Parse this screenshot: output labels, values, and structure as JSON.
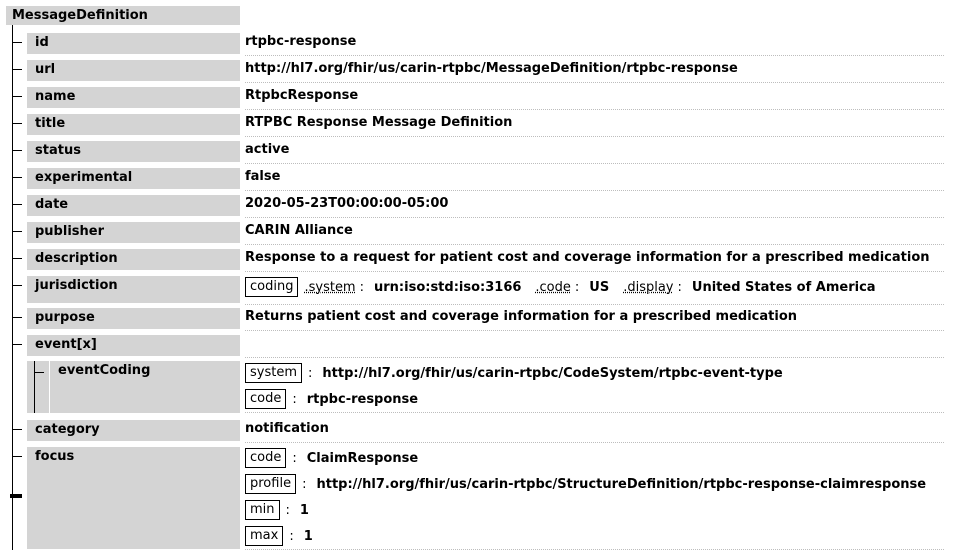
{
  "root_label": "MessageDefinition",
  "elements": {
    "id": {
      "label": "id",
      "value": "rtpbc-response"
    },
    "url": {
      "label": "url",
      "value": "http://hl7.org/fhir/us/carin-rtpbc/MessageDefinition/rtpbc-response"
    },
    "name": {
      "label": "name",
      "value": "RtpbcResponse"
    },
    "title": {
      "label": "title",
      "value": "RTPBC Response Message Definition"
    },
    "status": {
      "label": "status",
      "value": "active"
    },
    "experimental": {
      "label": "experimental",
      "value": "false"
    },
    "date": {
      "label": "date",
      "value": "2020-05-23T00:00:00-05:00"
    },
    "publisher": {
      "label": "publisher",
      "value": "CARIN Alliance"
    },
    "description": {
      "label": "description",
      "value": "Response to a request for patient cost and coverage information for a prescribed medication"
    },
    "jurisdiction": {
      "label": "jurisdiction",
      "coding_label": "coding",
      "system_label": ".system",
      "system_value": "urn:iso:std:iso:3166",
      "code_label": ".code",
      "code_value": "US",
      "display_label": ".display",
      "display_value": "United States of America"
    },
    "purpose": {
      "label": "purpose",
      "value": "Returns patient cost and coverage information for a prescribed medication"
    },
    "event": {
      "label": "event[x]",
      "eventCoding": {
        "label": "eventCoding",
        "system_label": "system",
        "system_value": "http://hl7.org/fhir/us/carin-rtpbc/CodeSystem/rtpbc-event-type",
        "code_label": "code",
        "code_value": "rtpbc-response"
      }
    },
    "category": {
      "label": "category",
      "value": "notification"
    },
    "focus": {
      "label": "focus",
      "code_label": "code",
      "code_value": "ClaimResponse",
      "profile_label": "profile",
      "profile_value": "http://hl7.org/fhir/us/carin-rtpbc/StructureDefinition/rtpbc-response-claimresponse",
      "min_label": "min",
      "min_value": "1",
      "max_label": "max",
      "max_value": "1"
    }
  },
  "colon": ":"
}
